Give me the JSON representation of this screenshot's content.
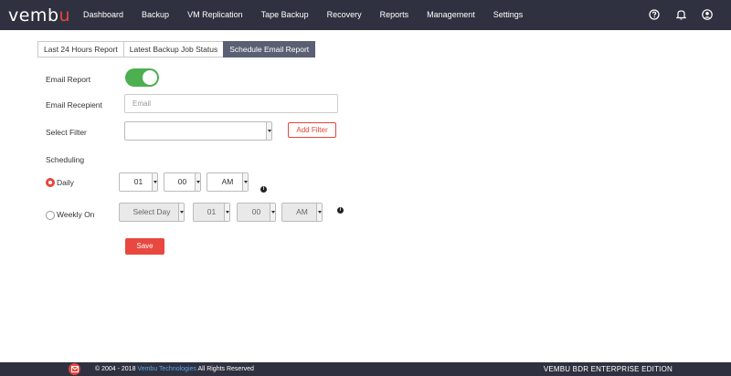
{
  "brand": {
    "logo_main": "vemb",
    "logo_accent": "u"
  },
  "nav": {
    "items": [
      "Dashboard",
      "Backup",
      "VM Replication",
      "Tape Backup",
      "Recovery",
      "Reports",
      "Management",
      "Settings"
    ],
    "icons": [
      "help-icon",
      "bell-icon",
      "user-icon"
    ]
  },
  "tabs": [
    {
      "label": "Last 24 Hours Report",
      "active": false
    },
    {
      "label": "Latest Backup Job Status",
      "active": false
    },
    {
      "label": "Schedule Email Report",
      "active": true
    }
  ],
  "form": {
    "email_report_label": "Email Report",
    "email_report_enabled": true,
    "email_recipient_label": "Email Recepient",
    "email_placeholder": "Email",
    "select_filter_label": "Select Filter",
    "select_filter_value": "",
    "add_filter_label": "Add Filter",
    "scheduling_label": "Scheduling",
    "daily": {
      "label": "Daily",
      "checked": true,
      "hour": "01",
      "minute": "00",
      "ampm": "AM"
    },
    "weekly": {
      "label": "Weekly On",
      "checked": false,
      "day": "Select Day",
      "hour": "01",
      "minute": "00",
      "ampm": "AM"
    },
    "info_glyph": "i",
    "save_label": "Save"
  },
  "footer": {
    "copyright_prefix": "© 2004 - 2018 ",
    "company_link": "Vembu Technologies",
    "copyright_suffix": " All Rights Reserved",
    "edition": "VEMBU BDR ENTERPRISE EDITION"
  },
  "colors": {
    "topbar": "#2f3140",
    "accent": "#e6453c",
    "toggle_on": "#4caf50",
    "active_tab": "#5a5f73"
  }
}
